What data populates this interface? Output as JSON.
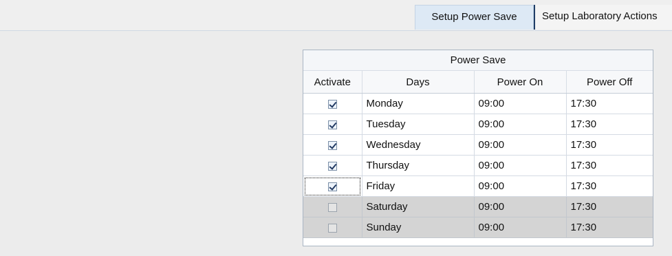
{
  "tabs": [
    {
      "label": "Setup Power Save",
      "active": true
    },
    {
      "label": "Setup Laboratory Actions",
      "active": false
    }
  ],
  "power_save": {
    "title": "Power Save",
    "columns": [
      "Activate",
      "Days",
      "Power On",
      "Power Off"
    ],
    "rows": [
      {
        "day": "Monday",
        "power_on": "09:00",
        "power_off": "17:30",
        "activate": true
      },
      {
        "day": "Tuesday",
        "power_on": "09:00",
        "power_off": "17:30",
        "activate": true
      },
      {
        "day": "Wednesday",
        "power_on": "09:00",
        "power_off": "17:30",
        "activate": true
      },
      {
        "day": "Thursday",
        "power_on": "09:00",
        "power_off": "17:30",
        "activate": true
      },
      {
        "day": "Friday",
        "power_on": "09:00",
        "power_off": "17:30",
        "activate": true,
        "focused": true
      },
      {
        "day": "Saturday",
        "power_on": "09:00",
        "power_off": "17:30",
        "activate": false
      },
      {
        "day": "Sunday",
        "power_on": "09:00",
        "power_off": "17:30",
        "activate": false
      }
    ]
  },
  "colors": {
    "active_tab": "#dde9f5",
    "inactive_row": "#d4d4d4",
    "check_mark": "#223a62"
  }
}
